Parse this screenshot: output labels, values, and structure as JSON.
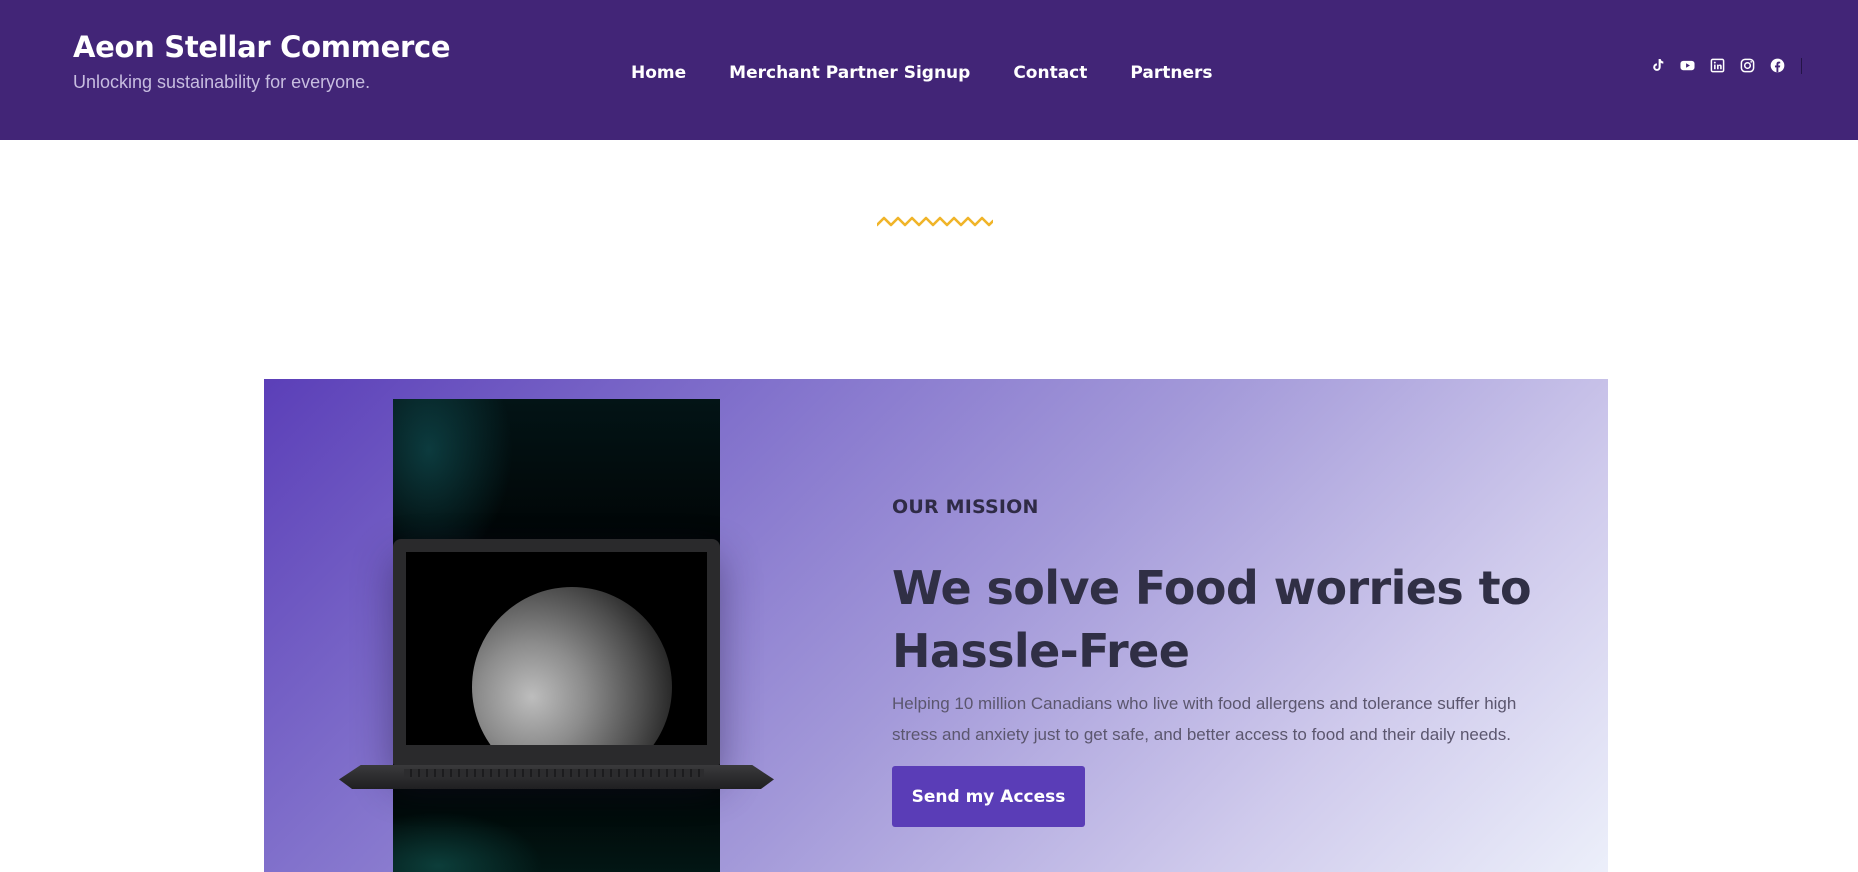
{
  "header": {
    "title": "Aeon Stellar Commerce",
    "tagline": "Unlocking sustainability for everyone.",
    "nav": [
      {
        "label": "Home"
      },
      {
        "label": "Merchant Partner Signup"
      },
      {
        "label": "Contact"
      },
      {
        "label": "Partners"
      }
    ],
    "social": [
      {
        "icon": "tiktok-icon"
      },
      {
        "icon": "youtube-icon"
      },
      {
        "icon": "linkedin-icon"
      },
      {
        "icon": "instagram-icon"
      },
      {
        "icon": "facebook-icon"
      }
    ]
  },
  "hero": {
    "eyebrow": "OUR MISSION",
    "heading": "We solve Food worries to Hassle-Free",
    "description": "Helping 10 million Canadians who live with food allergens and tolerance suffer high stress and anxiety just to get safe, and better access to food and their daily needs.",
    "cta_label": "Send my Access"
  },
  "colors": {
    "header_bg": "#422577",
    "accent": "#5a3db7",
    "zigzag": "#f0b429",
    "text_dark": "#302f45"
  }
}
